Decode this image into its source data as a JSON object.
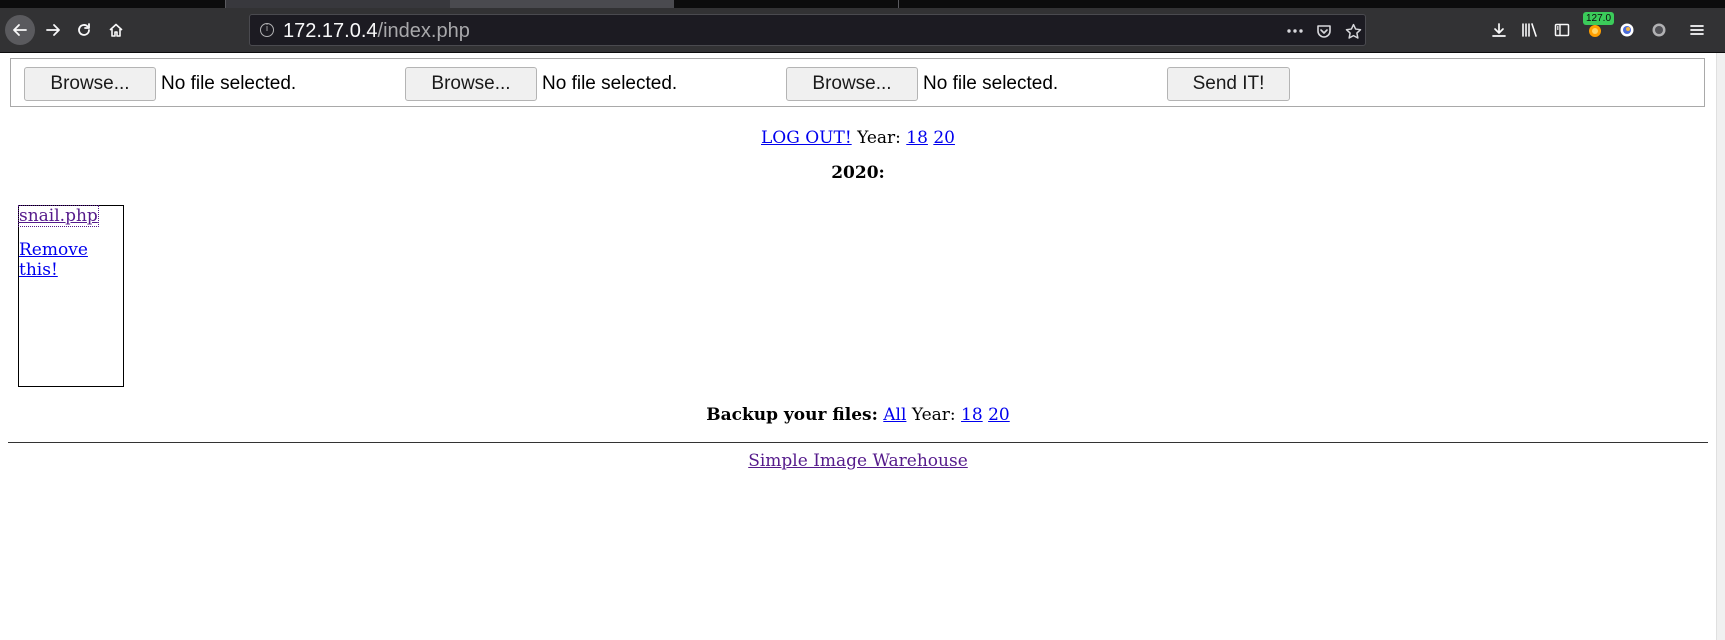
{
  "browser": {
    "url_host": "172.17.0.4",
    "url_path": "/index.php",
    "badge": "127.0"
  },
  "upload_form": {
    "slots": [
      {
        "button": "Browse...",
        "status": "No file selected."
      },
      {
        "button": "Browse...",
        "status": "No file selected."
      },
      {
        "button": "Browse...",
        "status": "No file selected."
      }
    ],
    "submit": "Send IT!"
  },
  "nav": {
    "logout": "LOG OUT!",
    "year_label": "Year:",
    "years": [
      "18",
      "20"
    ]
  },
  "section_heading": "2020:",
  "files": [
    {
      "name": "snail.php",
      "remove": "Remove this!"
    }
  ],
  "backup": {
    "label": "Backup your files:",
    "all": "All",
    "year_label": "Year:",
    "years": [
      "18",
      "20"
    ]
  },
  "footer": {
    "link": "Simple Image Warehouse"
  },
  "icons": [
    "back-arrow-icon",
    "forward-arrow-icon",
    "reload-icon",
    "home-icon",
    "info-icon",
    "more-actions-icon",
    "pocket-icon",
    "bookmark-star-icon",
    "download-icon",
    "library-icon",
    "sidebar-icon",
    "extension-icon",
    "account-icon",
    "circle-icon",
    "menu-icon"
  ]
}
